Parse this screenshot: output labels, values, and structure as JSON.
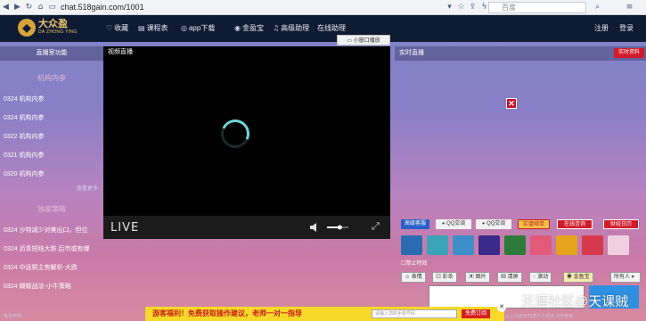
{
  "browser": {
    "url": "chat.518gain.com/1001",
    "search_placeholder": "百度"
  },
  "nav": {
    "logo_cn": "大众盈",
    "logo_en": "DA ZHONG YING",
    "items": [
      "收藏",
      "课程表",
      "app下载",
      "金盈宝",
      "高级助理",
      "在线助理"
    ],
    "register": "注册",
    "login": "登录"
  },
  "left": {
    "header": "直播室功能",
    "section1": "机构内参",
    "items1": [
      "0324 机构内参",
      "0324 机构内参",
      "0322 机构内参",
      "0321 机构内参",
      "0320 机构内参"
    ],
    "more": "查看更多",
    "section2": "独家策略",
    "items2": [
      "0324 沙特减少对美出口，但位",
      "0324 沥青短线大跌 后市或有爆",
      "0324 中远铜主势解析-大跌",
      "0324 蝴蝶战法-小牛策略"
    ]
  },
  "video": {
    "title": "视频直播",
    "popout": "小窗口播放",
    "live": "LIVE",
    "volume": 0.6
  },
  "right": {
    "header": "实时直播",
    "tab": "实时资料",
    "buttons": [
      "高级客服",
      "QQ交谈",
      "QQ交谈",
      "实盘喊单",
      "在线咨询",
      "财经日历"
    ],
    "ban": "禁止特效",
    "tools": [
      "表情",
      "彩条",
      "图片",
      "清屏",
      "滚动",
      "金盈宝"
    ],
    "target": "所有人",
    "colors": {
      "red": "#d11a2a",
      "blue": "#2a5fc7"
    }
  },
  "promo": {
    "text": "游客福利！免费获取操作建议，老师一对一指导",
    "input_placeholder": "请输入您的手机号码",
    "button": "免费订阅"
  },
  "footer": {
    "left": "免责声明",
    "right": "以上内容仅代表个人观点 只作参考"
  },
  "watermark": "天涯社区@天课贼"
}
